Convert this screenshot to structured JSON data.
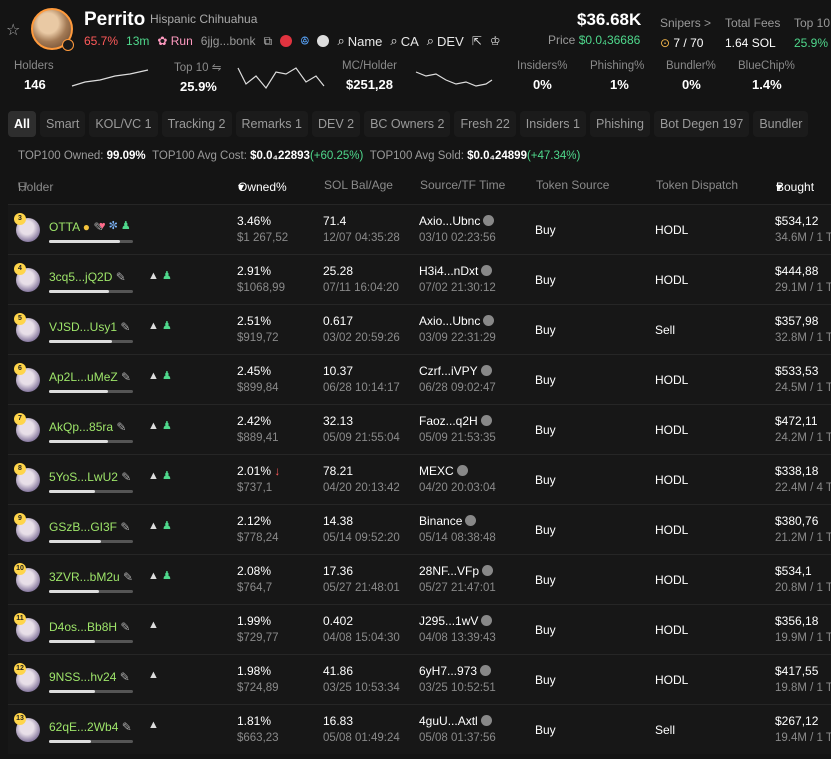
{
  "token": {
    "name": "Perrito",
    "fullname": "Hispanic Chihuahua",
    "change": "65.7%",
    "age": "13m",
    "run_label": "Run",
    "address": "6jjg...bonk",
    "links": {
      "name": "Name",
      "ca": "CA",
      "dev": "DEV"
    }
  },
  "price": {
    "mcap": "$36.68K",
    "label": "Price",
    "value": "$0.0₄36686"
  },
  "header_stats": [
    {
      "label": "Snipers >",
      "value": "7 / 70"
    },
    {
      "label": "Total Fees",
      "value": "1.64 SOL"
    },
    {
      "label": "Top 10",
      "value": "25.9%"
    }
  ],
  "stats": [
    {
      "label": "Holders",
      "value": "146"
    },
    {
      "label": "Top 10",
      "value": "25.9%"
    },
    {
      "label": "MC/Holder",
      "value": "$251,28"
    },
    {
      "label": "Insiders%",
      "value": "0%"
    },
    {
      "label": "Phishing%",
      "value": "1%"
    },
    {
      "label": "Bundler%",
      "value": "0%"
    },
    {
      "label": "BlueChip%",
      "value": "1.4%"
    }
  ],
  "tabs": [
    "All",
    "Smart",
    "KOL/VC 1",
    "Tracking 2",
    "Remarks 1",
    "DEV 2",
    "BC Owners 2",
    "Fresh 22",
    "Insiders 1",
    "Phishing",
    "Bot Degen 197",
    "Bundler"
  ],
  "summary": {
    "owned_label": "TOP100 Owned:",
    "owned": "99.09%",
    "cost_label": "TOP100 Avg Cost:",
    "cost": "$0.0₄22893",
    "cost_change": "(+60.25%)",
    "sold_label": "TOP100 Avg Sold:",
    "sold": "$0.0₄24899",
    "sold_change": "(+47.34%)"
  },
  "columns": [
    "Holder",
    "Owned%",
    "SOL Bal/Age",
    "Source/TF Time",
    "Token Source",
    "Token Dispatch",
    "Bought"
  ],
  "rows": [
    {
      "n": "3",
      "holder": "OTTA",
      "owned": "3.46%",
      "usd": "$1 267,52",
      "sol": "71.4",
      "age": "12/07 04:35:28",
      "src": "Axio...Ubnc",
      "time": "03/10 02:23:56",
      "token_source": "Buy",
      "dispatch": "HODL",
      "bought": "$534,12",
      "bought2": "34.6M / 1 T",
      "bar": 0.85
    },
    {
      "n": "4",
      "holder": "3cq5...jQ2D",
      "owned": "2.91%",
      "usd": "$1068,99",
      "sol": "25.28",
      "age": "07/11 16:04:20",
      "src": "H3i4...nDxt",
      "time": "07/02 21:30:12",
      "token_source": "Buy",
      "dispatch": "HODL",
      "bought": "$444,88",
      "bought2": "29.1M / 1 T",
      "bar": 0.72
    },
    {
      "n": "5",
      "holder": "VJSD...Usy1",
      "owned": "2.51%",
      "usd": "$919,72",
      "sol": "0.617",
      "age": "03/02 20:59:26",
      "src": "Axio...Ubnc",
      "time": "03/09 22:31:29",
      "token_source": "Buy",
      "dispatch": "Sell",
      "bought": "$357,98",
      "bought2": "32.8M / 1 T",
      "bar": 0.75
    },
    {
      "n": "6",
      "holder": "Ap2L...uMeZ",
      "owned": "2.45%",
      "usd": "$899,84",
      "sol": "10.37",
      "age": "06/28 10:14:17",
      "src": "Czrf...iVPY",
      "time": "06/28 09:02:47",
      "token_source": "Buy",
      "dispatch": "HODL",
      "bought": "$533,53",
      "bought2": "24.5M / 1 T",
      "bar": 0.7
    },
    {
      "n": "7",
      "holder": "AkQp...85ra",
      "owned": "2.42%",
      "usd": "$889,41",
      "sol": "32.13",
      "age": "05/09 21:55:04",
      "src": "Faoz...q2H",
      "time": "05/09 21:53:35",
      "token_source": "Buy",
      "dispatch": "HODL",
      "bought": "$472,11",
      "bought2": "24.2M / 1 T",
      "bar": 0.7
    },
    {
      "n": "8",
      "holder": "5YoS...LwU2",
      "owned": "2.01%",
      "usd": "$737,1",
      "sol": "78.21",
      "age": "04/20 20:13:42",
      "src": "MEXC",
      "time": "04/20 20:03:04",
      "token_source": "Buy",
      "dispatch": "HODL",
      "bought": "$338,18",
      "bought2": "22.4M / 4 T",
      "bar": 0.55
    },
    {
      "n": "9",
      "holder": "GSzB...GI3F",
      "owned": "2.12%",
      "usd": "$778,24",
      "sol": "14.38",
      "age": "05/14 09:52:20",
      "src": "Binance",
      "time": "05/14 08:38:48",
      "token_source": "Buy",
      "dispatch": "HODL",
      "bought": "$380,76",
      "bought2": "21.2M / 1 T",
      "bar": 0.62
    },
    {
      "n": "10",
      "holder": "3ZVR...bM2u",
      "owned": "2.08%",
      "usd": "$764,7",
      "sol": "17.36",
      "age": "05/27 21:48:01",
      "src": "28NF...VFp",
      "time": "05/27 21:47:01",
      "token_source": "Buy",
      "dispatch": "HODL",
      "bought": "$534,1",
      "bought2": "20.8M / 1 T",
      "bar": 0.6
    },
    {
      "n": "11",
      "holder": "D4os...Bb8H",
      "owned": "1.99%",
      "usd": "$729,77",
      "sol": "0.402",
      "age": "04/08 15:04:30",
      "src": "J295...1wV",
      "time": "04/08 13:39:43",
      "token_source": "Buy",
      "dispatch": "HODL",
      "bought": "$356,18",
      "bought2": "19.9M / 1 T",
      "bar": 0.55
    },
    {
      "n": "12",
      "holder": "9NSS...hv24",
      "owned": "1.98%",
      "usd": "$724,89",
      "sol": "41.86",
      "age": "03/25 10:53:34",
      "src": "6yH7...973",
      "time": "03/25 10:52:51",
      "token_source": "Buy",
      "dispatch": "HODL",
      "bought": "$417,55",
      "bought2": "19.8M / 1 T",
      "bar": 0.55
    },
    {
      "n": "13",
      "holder": "62qE...2Wb4",
      "owned": "1.81%",
      "usd": "$663,23",
      "sol": "16.83",
      "age": "05/08 01:49:24",
      "src": "4guU...Axtl",
      "time": "05/08 01:37:56",
      "token_source": "Buy",
      "dispatch": "Sell",
      "bought": "$267,12",
      "bought2": "19.4M / 1 T",
      "bar": 0.5
    }
  ]
}
